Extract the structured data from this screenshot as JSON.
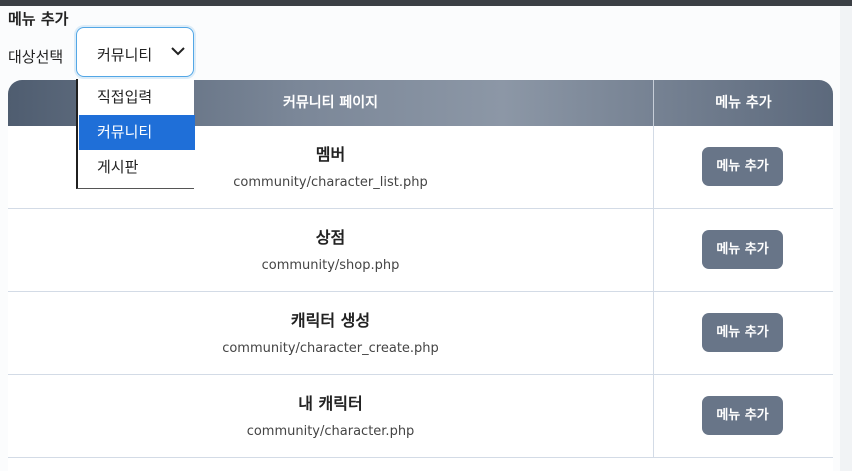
{
  "modal": {
    "title": "메뉴 추가"
  },
  "target": {
    "label": "대상선택",
    "selected": "커뮤니티",
    "options": [
      "직접입력",
      "커뮤니티",
      "게시판"
    ]
  },
  "table": {
    "headers": {
      "page": "커뮤니티 페이지",
      "add": "메뉴 추가"
    },
    "rows": [
      {
        "name": "멤버",
        "path": "community/character_list.php",
        "button": "메뉴 추가"
      },
      {
        "name": "상점",
        "path": "community/shop.php",
        "button": "메뉴 추가"
      },
      {
        "name": "캐릭터 생성",
        "path": "community/character_create.php",
        "button": "메뉴 추가"
      },
      {
        "name": "내 캐릭터",
        "path": "community/character.php",
        "button": "메뉴 추가"
      }
    ]
  },
  "colors": {
    "accent": "#1f6fd8",
    "button": "#687588",
    "header": "#6a7688"
  }
}
